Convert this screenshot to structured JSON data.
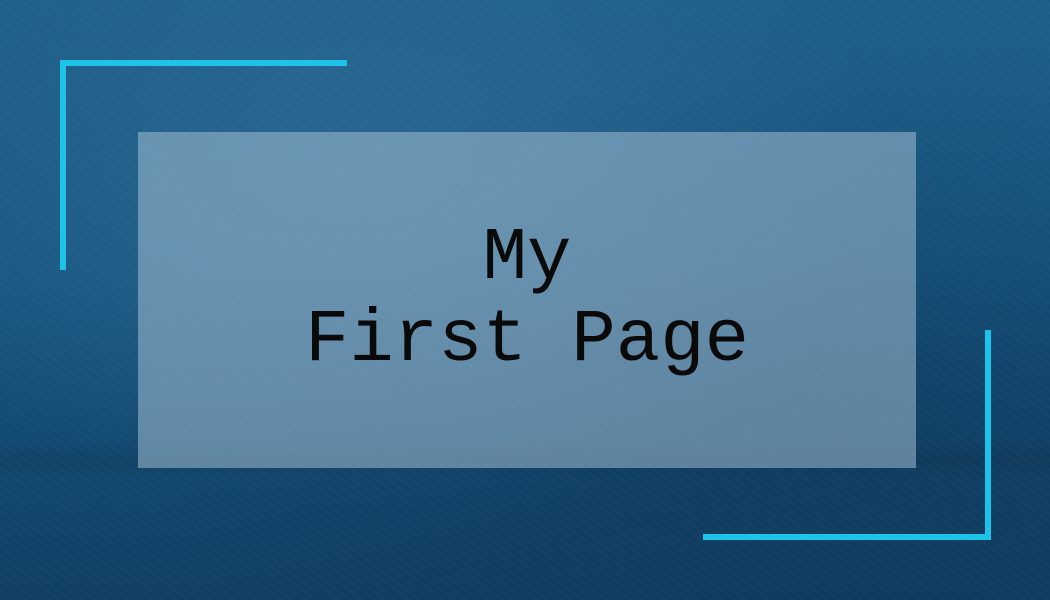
{
  "title": {
    "line1": "My",
    "line2": "First Page"
  },
  "colors": {
    "background": "#185680",
    "accent": "#1ec3e8",
    "panel": "#8fb0c6",
    "text": "#0a0a0a"
  }
}
